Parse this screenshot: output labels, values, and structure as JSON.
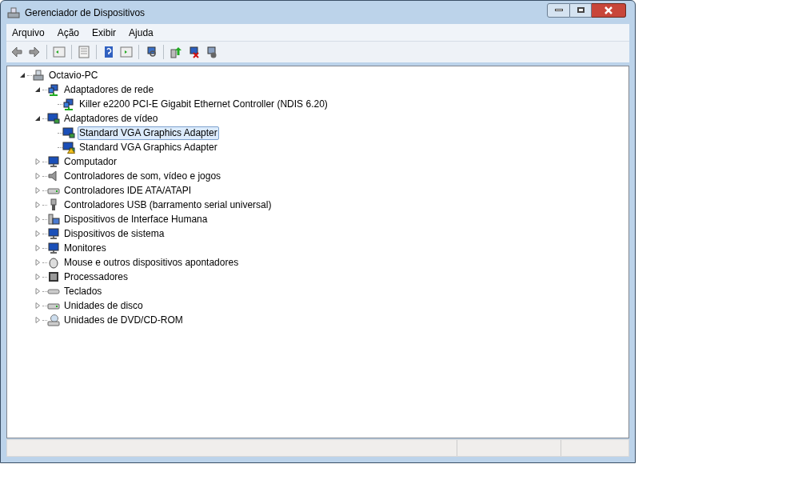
{
  "window": {
    "title": "Gerenciador de Dispositivos"
  },
  "menu": [
    "Arquivo",
    "Ação",
    "Exibir",
    "Ajuda"
  ],
  "tree": [
    {
      "label": "Octavio-PC",
      "kind": "pc",
      "expanded": true,
      "selected": false,
      "children": [
        {
          "label": "Adaptadores de rede",
          "kind": "network",
          "expanded": true,
          "selected": false,
          "children": [
            {
              "label": "Killer e2200 PCI-E Gigabit Ethernet Controller (NDIS 6.20)",
              "kind": "network",
              "selected": false,
              "warning": false
            }
          ]
        },
        {
          "label": "Adaptadores de vídeo",
          "kind": "display",
          "expanded": true,
          "selected": false,
          "children": [
            {
              "label": "Standard VGA Graphics Adapter",
              "kind": "display",
              "selected": true,
              "warning": false
            },
            {
              "label": "Standard VGA Graphics Adapter",
              "kind": "display",
              "selected": false,
              "warning": true
            }
          ]
        },
        {
          "label": "Computador",
          "kind": "monitor",
          "expanded": false,
          "selected": false
        },
        {
          "label": "Controladores de som, vídeo e jogos",
          "kind": "speaker",
          "expanded": false,
          "selected": false
        },
        {
          "label": "Controladores IDE ATA/ATAPI",
          "kind": "drive",
          "expanded": false,
          "selected": false
        },
        {
          "label": "Controladores USB (barramento serial universal)",
          "kind": "usb",
          "expanded": false,
          "selected": false
        },
        {
          "label": "Dispositivos de Interface Humana",
          "kind": "hid",
          "expanded": false,
          "selected": false
        },
        {
          "label": "Dispositivos de sistema",
          "kind": "monitor",
          "expanded": false,
          "selected": false
        },
        {
          "label": "Monitores",
          "kind": "monitor",
          "expanded": false,
          "selected": false
        },
        {
          "label": "Mouse e outros dispositivos apontadores",
          "kind": "mouse",
          "expanded": false,
          "selected": false
        },
        {
          "label": "Processadores",
          "kind": "cpu",
          "expanded": false,
          "selected": false
        },
        {
          "label": "Teclados",
          "kind": "keyboard",
          "expanded": false,
          "selected": false
        },
        {
          "label": "Unidades de disco",
          "kind": "drive",
          "expanded": false,
          "selected": false
        },
        {
          "label": "Unidades de DVD/CD-ROM",
          "kind": "dvd",
          "expanded": false,
          "selected": false
        }
      ]
    }
  ]
}
